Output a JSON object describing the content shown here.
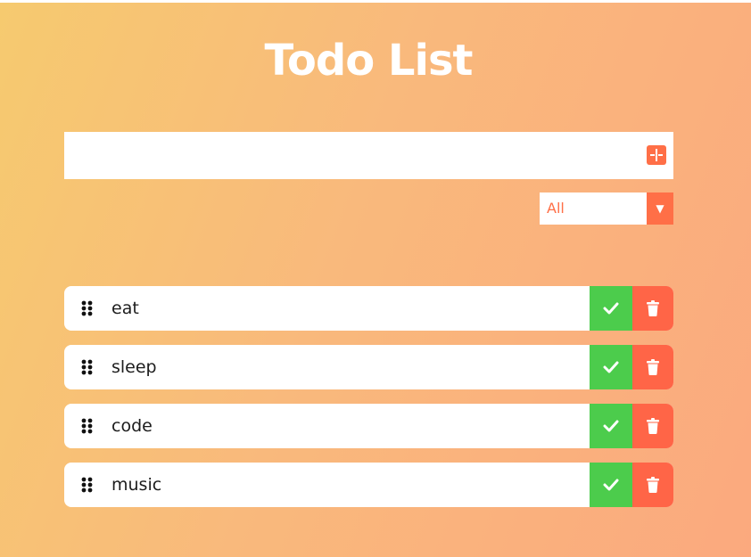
{
  "app": {
    "title": "Todo List"
  },
  "input": {
    "value": "",
    "placeholder": ""
  },
  "filter": {
    "selected": "All"
  },
  "colors": {
    "accent": "#ff6f47",
    "complete": "#4ccc4c",
    "delete": "#ff6547"
  },
  "icons": {
    "add": "add-icon",
    "filter_arrow": "caret-down-icon",
    "drag": "drag-handle-icon",
    "complete": "check-icon",
    "delete": "trash-icon"
  },
  "todos": [
    {
      "text": "eat"
    },
    {
      "text": "sleep"
    },
    {
      "text": "code"
    },
    {
      "text": "music"
    }
  ]
}
